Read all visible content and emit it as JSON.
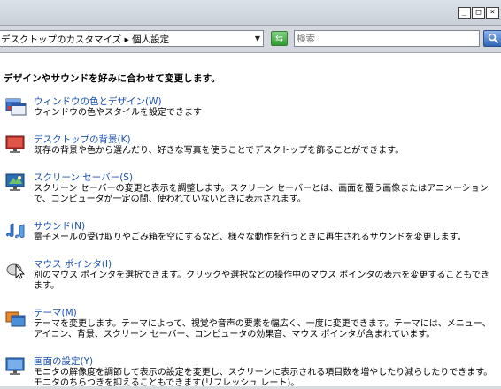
{
  "window": {
    "minimize_glyph": "_",
    "maximize_glyph": "□",
    "close_glyph": "×"
  },
  "addressbar": {
    "breadcrumb": "デスクトップのカスタマイズ ▸ 個人設定",
    "dropdown_glyph": "▼"
  },
  "refresh": {
    "glyph": "⇆"
  },
  "search": {
    "placeholder": "検索"
  },
  "main": {
    "heading": "デザインやサウンドを好みに合わせて変更します。",
    "items": [
      {
        "title": "ウィンドウの色とデザイン(W)",
        "description": "ウィンドウの色やスタイルを設定できます",
        "icon": "window-color-icon"
      },
      {
        "title": "デスクトップの背景(K)",
        "description": "既存の背景や色から選んだり、好きな写真を使うことでデスクトップを飾ることができます。",
        "icon": "desktop-background-icon"
      },
      {
        "title": "スクリーン セーバー(S)",
        "description": "スクリーン セーバーの変更と表示を調整します。スクリーン セーバーとは、画面を覆う画像またはアニメーションで、コンピュータが一定の間、使われていないときに表示されます。",
        "icon": "screen-saver-icon"
      },
      {
        "title": "サウンド(N)",
        "description": "電子メールの受け取りやごみ箱を空にするなど、様々な動作を行うときに再生されるサウンドを変更します。",
        "icon": "sound-icon"
      },
      {
        "title": "マウス ポインタ(I)",
        "description": "別のマウス ポインタを選択できます。クリックや選択などの操作中のマウス ポインタの表示を変更することもできます。",
        "icon": "mouse-pointer-icon"
      },
      {
        "title": "テーマ(M)",
        "description": "テーマを変更します。テーマによって、視覚や音声の要素を幅広く、一度に変更できます。テーマには、メニュー、アイコン、背景、スクリーン セーバー、コンピュータの効果音、マウス ポインタが含まれています。",
        "icon": "theme-icon"
      },
      {
        "title": "画面の設定(Y)",
        "description": "モニタの解像度を調節して表示の設定を変更し、スクリーンに表示される項目数を増やしたり減らしたりできます。モニタのちらつきを抑えることもできます(リフレッシュ レート)。",
        "icon": "display-settings-icon"
      }
    ]
  }
}
